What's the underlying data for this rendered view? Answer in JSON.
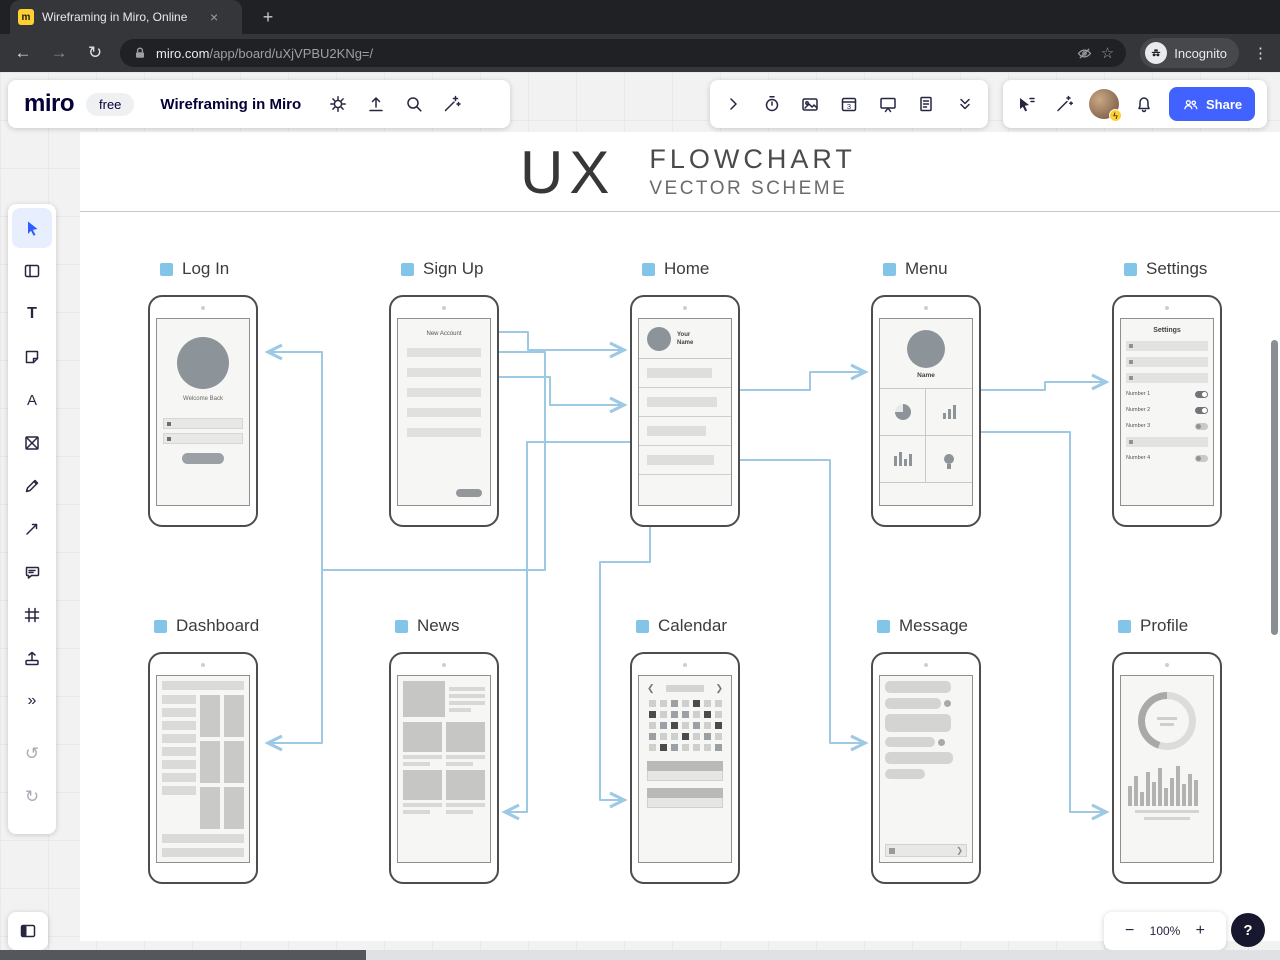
{
  "browser": {
    "tab_title": "Wireframing in Miro, Online",
    "url_domain": "miro.com",
    "url_path": "/app/board/uXjVPBU2KNg=/",
    "incognito_label": "Incognito"
  },
  "header": {
    "logo_text": "miro",
    "plan_badge": "free",
    "board_title": "Wireframing in Miro",
    "share_button": "Share"
  },
  "canvas": {
    "heading": {
      "main": "UX",
      "line1": "FLOWCHART",
      "line2": "VECTOR SCHEME"
    },
    "screens": {
      "login": {
        "label": "Log In",
        "welcome_text": "Welcome Back"
      },
      "signup": {
        "label": "Sign Up",
        "header_text": "New Account"
      },
      "home": {
        "label": "Home",
        "name_line1": "Your",
        "name_line2": "Name"
      },
      "menu": {
        "label": "Menu",
        "name_text": "Name"
      },
      "settings": {
        "label": "Settings",
        "header_text": "Settings",
        "row_labels": [
          "Number 1",
          "Number 2",
          "Number 3",
          "Number 4"
        ]
      },
      "dashboard": {
        "label": "Dashboard"
      },
      "news": {
        "label": "News"
      },
      "calendar": {
        "label": "Calendar"
      },
      "message": {
        "label": "Message"
      },
      "profile": {
        "label": "Profile"
      }
    }
  },
  "zoom_controls": {
    "zoom_out": "−",
    "zoom_level": "100%",
    "zoom_in": "+",
    "help": "?"
  },
  "accent_colors": {
    "connector_blue": "#9ec9e4",
    "label_square_blue": "#82c5e8",
    "share_blue": "#4262ff"
  }
}
